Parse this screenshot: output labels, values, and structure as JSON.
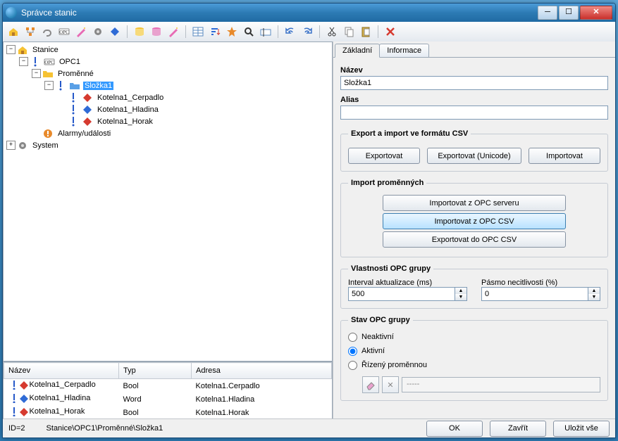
{
  "window_title": "Správce stanic",
  "toolbar_icons": [
    "new-station",
    "structure",
    "link",
    "opc",
    "magic",
    "gear",
    "thing",
    "sep",
    "db-yellow",
    "db",
    "wand",
    "sep",
    "grid",
    "sort",
    "star",
    "find",
    "rename",
    "sep",
    "undo",
    "redo",
    "sep",
    "cut",
    "copy",
    "paste",
    "sep",
    "delete"
  ],
  "tree": [
    {
      "indent": 0,
      "twist": "-",
      "icon": "house",
      "label": "Stanice"
    },
    {
      "indent": 1,
      "twist": "-",
      "icon": "opc",
      "label": "OPC1",
      "pre": "ex"
    },
    {
      "indent": 2,
      "twist": "-",
      "icon": "folder",
      "label": "Proměnné"
    },
    {
      "indent": 3,
      "twist": "-",
      "icon": "folder-blue",
      "label": "Složka1",
      "selected": true,
      "pre": "ex"
    },
    {
      "indent": 4,
      "twist": "",
      "icon": "diamond-red",
      "label": "Kotelna1_Cerpadlo",
      "pre": "ex"
    },
    {
      "indent": 4,
      "twist": "",
      "icon": "diamond-blue",
      "label": "Kotelna1_Hladina",
      "pre": "ex"
    },
    {
      "indent": 4,
      "twist": "",
      "icon": "diamond-red",
      "label": "Kotelna1_Horak",
      "pre": "ex"
    },
    {
      "indent": 2,
      "twist": "",
      "icon": "alarm",
      "label": "Alarmy/události"
    },
    {
      "indent": 0,
      "twist": "+",
      "icon": "gear",
      "label": "System"
    }
  ],
  "list": {
    "columns": [
      "Název",
      "Typ",
      "Adresa"
    ],
    "rows": [
      {
        "icon": "diamond-red",
        "name": "Kotelna1_Cerpadlo",
        "type": "Bool",
        "addr": "Kotelna1.Cerpadlo"
      },
      {
        "icon": "diamond-blue",
        "name": "Kotelna1_Hladina",
        "type": "Word",
        "addr": "Kotelna1.Hladina"
      },
      {
        "icon": "diamond-red",
        "name": "Kotelna1_Horak",
        "type": "Bool",
        "addr": "Kotelna1.Horak"
      }
    ]
  },
  "tabs": [
    {
      "label": "Základní",
      "active": true
    },
    {
      "label": "Informace",
      "active": false
    }
  ],
  "form": {
    "name_label": "Název",
    "name_value": "Složka1",
    "alias_label": "Alias",
    "alias_value": "",
    "csv_legend": "Export a import ve formátu CSV",
    "btn_export": "Exportovat",
    "btn_export_u": "Exportovat (Unicode)",
    "btn_import": "Importovat",
    "impvar_legend": "Import proměnných",
    "btn_imp_opc_srv": "Importovat z OPC serveru",
    "btn_imp_opc_csv": "Importovat z OPC CSV",
    "btn_exp_opc_csv": "Exportovat do OPC CSV",
    "opcgrp_legend": "Vlastnosti OPC grupy",
    "interval_label": "Interval aktualizace (ms)",
    "interval_value": "500",
    "deadband_label": "Pásmo necitlivosti (%)",
    "deadband_value": "0",
    "state_legend": "Stav OPC grupy",
    "state_inactive": "Neaktivní",
    "state_active": "Aktivní",
    "state_variable": "Řízený proměnnou",
    "state_sel": "active",
    "var_display": "-----"
  },
  "status": {
    "id": "ID=2",
    "path": "Stanice\\OPC1\\Proměnné\\Složka1"
  },
  "buttons": {
    "ok": "OK",
    "close": "Zavřít",
    "saveall": "Uložit vše"
  }
}
